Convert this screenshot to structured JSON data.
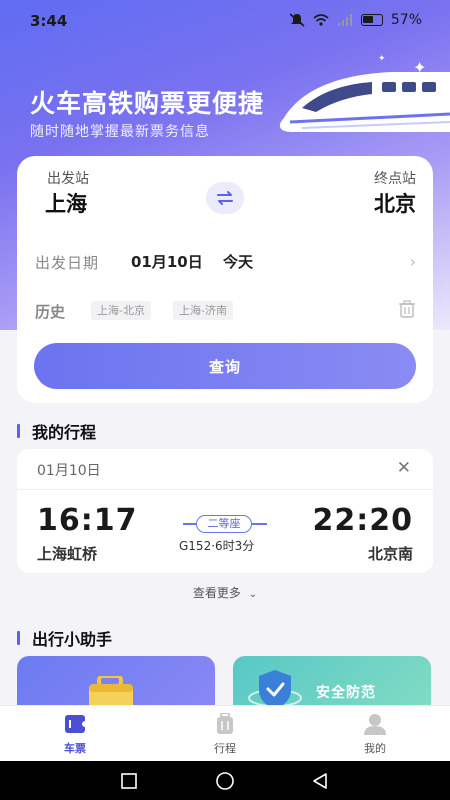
{
  "status_bar": {
    "time": "3:44",
    "battery": "57%"
  },
  "hero": {
    "title": "火车高铁购票更便捷",
    "subtitle": "随时随地掌握最新票务信息"
  },
  "search": {
    "from_label": "出发站",
    "from_city": "上海",
    "to_label": "终点站",
    "to_city": "北京",
    "date_label": "出发日期",
    "date_value": "01月10日",
    "date_relative": "今天",
    "history_label": "历史",
    "history_items": [
      "上海-北京",
      "上海-济南"
    ],
    "query_button": "查询"
  },
  "my_trips": {
    "title": "我的行程",
    "trip": {
      "date": "01月10日",
      "depart_time": "16:17",
      "depart_station": "上海虹桥",
      "arrive_time": "22:20",
      "arrive_station": "北京南",
      "seat_class": "二等座",
      "train_info": "G152·6时3分"
    },
    "see_more": "查看更多"
  },
  "assistant": {
    "title": "出行小助手",
    "cards": [
      "安全防范"
    ]
  },
  "tabs": [
    {
      "label": "车票",
      "icon": "ticket-icon",
      "active": true
    },
    {
      "label": "行程",
      "icon": "luggage-icon",
      "active": false
    },
    {
      "label": "我的",
      "icon": "user-icon",
      "active": false
    }
  ],
  "colors": {
    "accent": "#5c63e8",
    "header_start": "#5f6cf2",
    "safety_card": "#58c8c6"
  }
}
